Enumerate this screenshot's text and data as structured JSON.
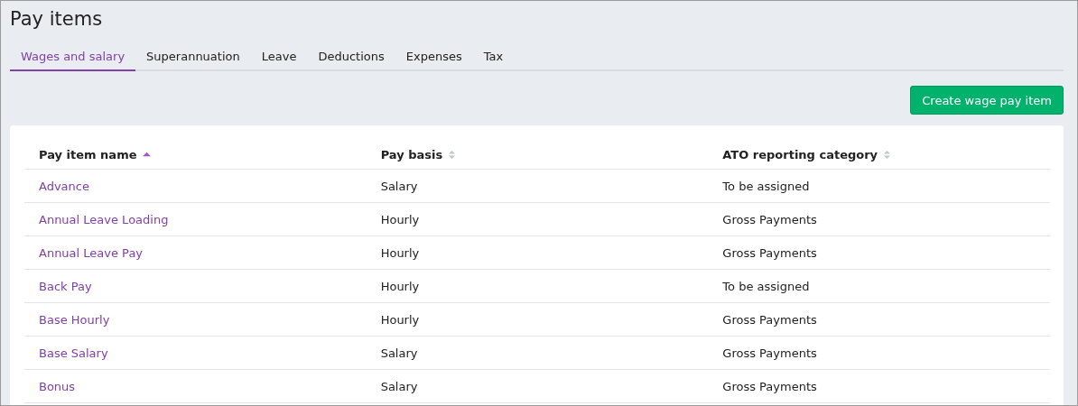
{
  "page": {
    "title": "Pay items"
  },
  "tabs": [
    {
      "label": "Wages and salary",
      "selected": true
    },
    {
      "label": "Superannuation",
      "selected": false
    },
    {
      "label": "Leave",
      "selected": false
    },
    {
      "label": "Deductions",
      "selected": false
    },
    {
      "label": "Expenses",
      "selected": false
    },
    {
      "label": "Tax",
      "selected": false
    }
  ],
  "actions": {
    "create_button": "Create wage pay item"
  },
  "table": {
    "columns": [
      {
        "label": "Pay item name",
        "sorted": true
      },
      {
        "label": "Pay basis",
        "sorted": false
      },
      {
        "label": "ATO reporting category",
        "sorted": false
      }
    ],
    "rows": [
      [
        "Advance",
        "Salary",
        "To be assigned"
      ],
      [
        "Annual Leave Loading",
        "Hourly",
        "Gross Payments"
      ],
      [
        "Annual Leave Pay",
        "Hourly",
        "Gross Payments"
      ],
      [
        "Back Pay",
        "Hourly",
        "To be assigned"
      ],
      [
        "Base Hourly",
        "Hourly",
        "Gross Payments"
      ],
      [
        "Base Salary",
        "Salary",
        "Gross Payments"
      ],
      [
        "Bonus",
        "Salary",
        "Gross Payments"
      ]
    ]
  }
}
